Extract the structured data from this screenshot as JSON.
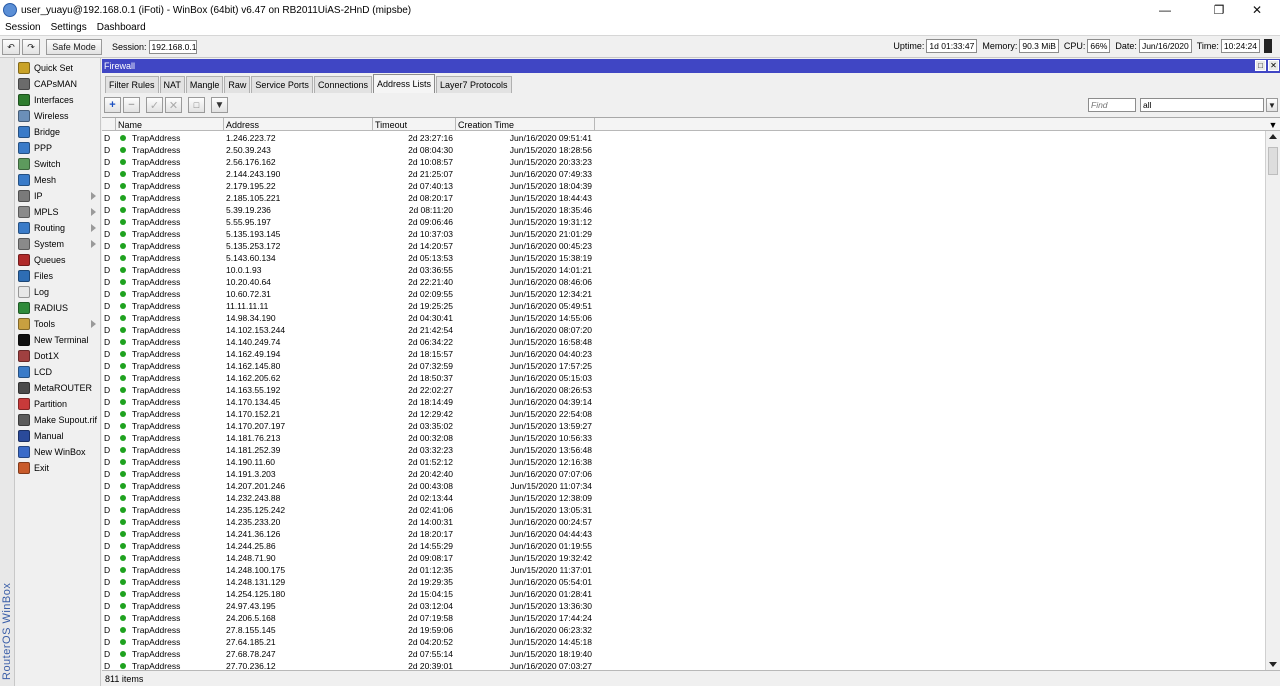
{
  "window": {
    "title": "user_yuayu@192.168.0.1 (iFoti) - WinBox (64bit) v6.47 on RB2011UiAS-2HnD (mipsbe)"
  },
  "menubar": [
    "Session",
    "Settings",
    "Dashboard"
  ],
  "toolbar": {
    "safe_mode_label": "Safe Mode",
    "session_label": "Session:",
    "session_value": "192.168.0.1",
    "uptime_label": "Uptime:",
    "uptime_value": "1d 01:33:47",
    "memory_label": "Memory:",
    "memory_value": "90.3 MiB",
    "cpu_label": "CPU:",
    "cpu_value": "66%",
    "date_label": "Date:",
    "date_value": "Jun/16/2020",
    "time_label": "Time:",
    "time_value": "10:24:24"
  },
  "vstrip_text": "RouterOS WinBox",
  "sidebar": {
    "items": [
      {
        "label": "Quick Set",
        "icon": "quick-set-icon",
        "color": "#c9a227",
        "arrow": false
      },
      {
        "label": "CAPsMAN",
        "icon": "capsman-icon",
        "color": "#6b6b6b",
        "arrow": false
      },
      {
        "label": "Interfaces",
        "icon": "interfaces-icon",
        "color": "#2f7d2f",
        "arrow": false
      },
      {
        "label": "Wireless",
        "icon": "wireless-icon",
        "color": "#6b8fb8",
        "arrow": false
      },
      {
        "label": "Bridge",
        "icon": "bridge-icon",
        "color": "#3a7bc8",
        "arrow": false
      },
      {
        "label": "PPP",
        "icon": "ppp-icon",
        "color": "#3a7bc8",
        "arrow": false
      },
      {
        "label": "Switch",
        "icon": "switch-icon",
        "color": "#5d9a5d",
        "arrow": false
      },
      {
        "label": "Mesh",
        "icon": "mesh-icon",
        "color": "#3a7bc8",
        "arrow": false
      },
      {
        "label": "IP",
        "icon": "ip-icon",
        "color": "#7a7a7a",
        "arrow": true
      },
      {
        "label": "MPLS",
        "icon": "mpls-icon",
        "color": "#8a8a8a",
        "arrow": true
      },
      {
        "label": "Routing",
        "icon": "routing-icon",
        "color": "#3a7bc8",
        "arrow": true
      },
      {
        "label": "System",
        "icon": "system-icon",
        "color": "#8a8a8a",
        "arrow": true
      },
      {
        "label": "Queues",
        "icon": "queues-icon",
        "color": "#b02a2a",
        "arrow": false
      },
      {
        "label": "Files",
        "icon": "files-icon",
        "color": "#2e6db4",
        "arrow": false
      },
      {
        "label": "Log",
        "icon": "log-icon",
        "color": "#e8e8e8",
        "arrow": false
      },
      {
        "label": "RADIUS",
        "icon": "radius-icon",
        "color": "#2f8a3a",
        "arrow": false
      },
      {
        "label": "Tools",
        "icon": "tools-icon",
        "color": "#c8a040",
        "arrow": true
      },
      {
        "label": "New Terminal",
        "icon": "terminal-icon",
        "color": "#111111",
        "arrow": false
      },
      {
        "label": "Dot1X",
        "icon": "dot1x-icon",
        "color": "#a04040",
        "arrow": false
      },
      {
        "label": "LCD",
        "icon": "lcd-icon",
        "color": "#3a7bc8",
        "arrow": false
      },
      {
        "label": "MetaROUTER",
        "icon": "metarouter-icon",
        "color": "#4a4a4a",
        "arrow": false
      },
      {
        "label": "Partition",
        "icon": "partition-icon",
        "color": "#c83a3a",
        "arrow": false
      },
      {
        "label": "Make Supout.rif",
        "icon": "supout-icon",
        "color": "#5a5a5a",
        "arrow": false
      },
      {
        "label": "Manual",
        "icon": "manual-icon",
        "color": "#2a4a9a",
        "arrow": false
      },
      {
        "label": "New WinBox",
        "icon": "new-winbox-icon",
        "color": "#3a6ac8",
        "arrow": false
      },
      {
        "label": "Exit",
        "icon": "exit-icon",
        "color": "#c85a2a",
        "arrow": false
      }
    ]
  },
  "panel": {
    "title": "Firewall",
    "tabs": [
      "Filter Rules",
      "NAT",
      "Mangle",
      "Raw",
      "Service Ports",
      "Connections",
      "Address Lists",
      "Layer7 Protocols"
    ],
    "active_tab": 6,
    "find_placeholder": "Find",
    "filter_value": "all",
    "columns": [
      "Name",
      "Address",
      "Timeout",
      "Creation Time"
    ],
    "status": "811 items"
  },
  "rows": [
    {
      "flag": "D",
      "name": "TrapAddress",
      "address": "1.246.223.72",
      "timeout": "2d 23:27:16",
      "created": "Jun/16/2020 09:51:41"
    },
    {
      "flag": "D",
      "name": "TrapAddress",
      "address": "2.50.39.243",
      "timeout": "2d 08:04:30",
      "created": "Jun/15/2020 18:28:56"
    },
    {
      "flag": "D",
      "name": "TrapAddress",
      "address": "2.56.176.162",
      "timeout": "2d 10:08:57",
      "created": "Jun/15/2020 20:33:23"
    },
    {
      "flag": "D",
      "name": "TrapAddress",
      "address": "2.144.243.190",
      "timeout": "2d 21:25:07",
      "created": "Jun/16/2020 07:49:33"
    },
    {
      "flag": "D",
      "name": "TrapAddress",
      "address": "2.179.195.22",
      "timeout": "2d 07:40:13",
      "created": "Jun/15/2020 18:04:39"
    },
    {
      "flag": "D",
      "name": "TrapAddress",
      "address": "2.185.105.221",
      "timeout": "2d 08:20:17",
      "created": "Jun/15/2020 18:44:43"
    },
    {
      "flag": "D",
      "name": "TrapAddress",
      "address": "5.39.19.236",
      "timeout": "2d 08:11:20",
      "created": "Jun/15/2020 18:35:46"
    },
    {
      "flag": "D",
      "name": "TrapAddress",
      "address": "5.55.95.197",
      "timeout": "2d 09:06:46",
      "created": "Jun/15/2020 19:31:12"
    },
    {
      "flag": "D",
      "name": "TrapAddress",
      "address": "5.135.193.145",
      "timeout": "2d 10:37:03",
      "created": "Jun/15/2020 21:01:29"
    },
    {
      "flag": "D",
      "name": "TrapAddress",
      "address": "5.135.253.172",
      "timeout": "2d 14:20:57",
      "created": "Jun/16/2020 00:45:23"
    },
    {
      "flag": "D",
      "name": "TrapAddress",
      "address": "5.143.60.134",
      "timeout": "2d 05:13:53",
      "created": "Jun/15/2020 15:38:19"
    },
    {
      "flag": "D",
      "name": "TrapAddress",
      "address": "10.0.1.93",
      "timeout": "2d 03:36:55",
      "created": "Jun/15/2020 14:01:21"
    },
    {
      "flag": "D",
      "name": "TrapAddress",
      "address": "10.20.40.64",
      "timeout": "2d 22:21:40",
      "created": "Jun/16/2020 08:46:06"
    },
    {
      "flag": "D",
      "name": "TrapAddress",
      "address": "10.60.72.31",
      "timeout": "2d 02:09:55",
      "created": "Jun/15/2020 12:34:21"
    },
    {
      "flag": "D",
      "name": "TrapAddress",
      "address": "11.11.11.11",
      "timeout": "2d 19:25:25",
      "created": "Jun/16/2020 05:49:51"
    },
    {
      "flag": "D",
      "name": "TrapAddress",
      "address": "14.98.34.190",
      "timeout": "2d 04:30:41",
      "created": "Jun/15/2020 14:55:06"
    },
    {
      "flag": "D",
      "name": "TrapAddress",
      "address": "14.102.153.244",
      "timeout": "2d 21:42:54",
      "created": "Jun/16/2020 08:07:20"
    },
    {
      "flag": "D",
      "name": "TrapAddress",
      "address": "14.140.249.74",
      "timeout": "2d 06:34:22",
      "created": "Jun/15/2020 16:58:48"
    },
    {
      "flag": "D",
      "name": "TrapAddress",
      "address": "14.162.49.194",
      "timeout": "2d 18:15:57",
      "created": "Jun/16/2020 04:40:23"
    },
    {
      "flag": "D",
      "name": "TrapAddress",
      "address": "14.162.145.80",
      "timeout": "2d 07:32:59",
      "created": "Jun/15/2020 17:57:25"
    },
    {
      "flag": "D",
      "name": "TrapAddress",
      "address": "14.162.205.62",
      "timeout": "2d 18:50:37",
      "created": "Jun/16/2020 05:15:03"
    },
    {
      "flag": "D",
      "name": "TrapAddress",
      "address": "14.163.55.192",
      "timeout": "2d 22:02:27",
      "created": "Jun/16/2020 08:26:53"
    },
    {
      "flag": "D",
      "name": "TrapAddress",
      "address": "14.170.134.45",
      "timeout": "2d 18:14:49",
      "created": "Jun/16/2020 04:39:14"
    },
    {
      "flag": "D",
      "name": "TrapAddress",
      "address": "14.170.152.21",
      "timeout": "2d 12:29:42",
      "created": "Jun/15/2020 22:54:08"
    },
    {
      "flag": "D",
      "name": "TrapAddress",
      "address": "14.170.207.197",
      "timeout": "2d 03:35:02",
      "created": "Jun/15/2020 13:59:27"
    },
    {
      "flag": "D",
      "name": "TrapAddress",
      "address": "14.181.76.213",
      "timeout": "2d 00:32:08",
      "created": "Jun/15/2020 10:56:33"
    },
    {
      "flag": "D",
      "name": "TrapAddress",
      "address": "14.181.252.39",
      "timeout": "2d 03:32:23",
      "created": "Jun/15/2020 13:56:48"
    },
    {
      "flag": "D",
      "name": "TrapAddress",
      "address": "14.190.11.60",
      "timeout": "2d 01:52:12",
      "created": "Jun/15/2020 12:16:38"
    },
    {
      "flag": "D",
      "name": "TrapAddress",
      "address": "14.191.3.203",
      "timeout": "2d 20:42:40",
      "created": "Jun/16/2020 07:07:06"
    },
    {
      "flag": "D",
      "name": "TrapAddress",
      "address": "14.207.201.246",
      "timeout": "2d 00:43:08",
      "created": "Jun/15/2020 11:07:34"
    },
    {
      "flag": "D",
      "name": "TrapAddress",
      "address": "14.232.243.88",
      "timeout": "2d 02:13:44",
      "created": "Jun/15/2020 12:38:09"
    },
    {
      "flag": "D",
      "name": "TrapAddress",
      "address": "14.235.125.242",
      "timeout": "2d 02:41:06",
      "created": "Jun/15/2020 13:05:31"
    },
    {
      "flag": "D",
      "name": "TrapAddress",
      "address": "14.235.233.20",
      "timeout": "2d 14:00:31",
      "created": "Jun/16/2020 00:24:57"
    },
    {
      "flag": "D",
      "name": "TrapAddress",
      "address": "14.241.36.126",
      "timeout": "2d 18:20:17",
      "created": "Jun/16/2020 04:44:43"
    },
    {
      "flag": "D",
      "name": "TrapAddress",
      "address": "14.244.25.86",
      "timeout": "2d 14:55:29",
      "created": "Jun/16/2020 01:19:55"
    },
    {
      "flag": "D",
      "name": "TrapAddress",
      "address": "14.248.71.90",
      "timeout": "2d 09:08:17",
      "created": "Jun/15/2020 19:32:42"
    },
    {
      "flag": "D",
      "name": "TrapAddress",
      "address": "14.248.100.175",
      "timeout": "2d 01:12:35",
      "created": "Jun/15/2020 11:37:01"
    },
    {
      "flag": "D",
      "name": "TrapAddress",
      "address": "14.248.131.129",
      "timeout": "2d 19:29:35",
      "created": "Jun/16/2020 05:54:01"
    },
    {
      "flag": "D",
      "name": "TrapAddress",
      "address": "14.254.125.180",
      "timeout": "2d 15:04:15",
      "created": "Jun/16/2020 01:28:41"
    },
    {
      "flag": "D",
      "name": "TrapAddress",
      "address": "24.97.43.195",
      "timeout": "2d 03:12:04",
      "created": "Jun/15/2020 13:36:30"
    },
    {
      "flag": "D",
      "name": "TrapAddress",
      "address": "24.206.5.168",
      "timeout": "2d 07:19:58",
      "created": "Jun/15/2020 17:44:24"
    },
    {
      "flag": "D",
      "name": "TrapAddress",
      "address": "27.8.155.145",
      "timeout": "2d 19:59:06",
      "created": "Jun/16/2020 06:23:32"
    },
    {
      "flag": "D",
      "name": "TrapAddress",
      "address": "27.64.185.21",
      "timeout": "2d 04:20:52",
      "created": "Jun/15/2020 14:45:18"
    },
    {
      "flag": "D",
      "name": "TrapAddress",
      "address": "27.68.78.247",
      "timeout": "2d 07:55:14",
      "created": "Jun/15/2020 18:19:40"
    },
    {
      "flag": "D",
      "name": "TrapAddress",
      "address": "27.70.236.12",
      "timeout": "2d 20:39:01",
      "created": "Jun/16/2020 07:03:27"
    }
  ]
}
